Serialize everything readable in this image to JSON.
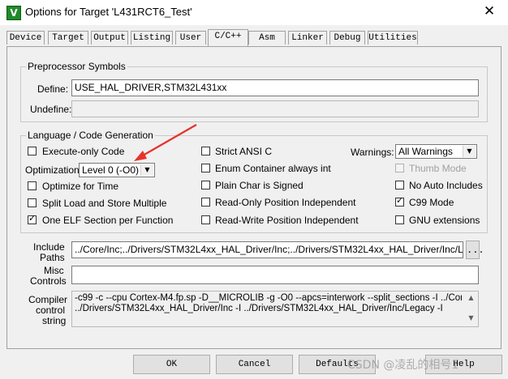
{
  "window": {
    "title": "Options for Target 'L431RCT6_Test'",
    "close_glyph": "✕"
  },
  "tabs": [
    {
      "label": "Device"
    },
    {
      "label": "Target"
    },
    {
      "label": "Output"
    },
    {
      "label": "Listing"
    },
    {
      "label": "User"
    },
    {
      "label": "C/C++"
    },
    {
      "label": "Asm"
    },
    {
      "label": "Linker"
    },
    {
      "label": "Debug"
    },
    {
      "label": "Utilities"
    }
  ],
  "active_tab": "C/C++",
  "preprocessor": {
    "group_label": "Preprocessor Symbols",
    "define_label": "Define:",
    "define_value": "USE_HAL_DRIVER,STM32L431xx",
    "undefine_label": "Undefine:",
    "undefine_value": ""
  },
  "language": {
    "group_label": "Language / Code Generation",
    "execute_only": {
      "label": "Execute-only Code",
      "checked": false
    },
    "optimization_label": "Optimization:",
    "optimization_value": "Level 0 (-O0)",
    "optimize_time": {
      "label": "Optimize for Time",
      "checked": false
    },
    "split_load": {
      "label": "Split Load and Store Multiple",
      "checked": false
    },
    "one_elf": {
      "label": "One ELF Section per Function",
      "checked": true
    },
    "strict_ansi": {
      "label": "Strict ANSI C",
      "checked": false
    },
    "enum_container": {
      "label": "Enum Container always int",
      "checked": false
    },
    "plain_char": {
      "label": "Plain Char is Signed",
      "checked": false
    },
    "readonly_pos": {
      "label": "Read-Only Position Independent",
      "checked": false
    },
    "readwrite_pos": {
      "label": "Read-Write Position Independent",
      "checked": false
    },
    "warnings_label": "Warnings:",
    "warnings_value": "All Warnings",
    "thumb_mode": {
      "label": "Thumb Mode",
      "checked": false,
      "disabled": true
    },
    "no_auto_includes": {
      "label": "No Auto Includes",
      "checked": false
    },
    "c99_mode": {
      "label": "C99 Mode",
      "checked": true
    },
    "gnu_extensions": {
      "label": "GNU extensions",
      "checked": false
    }
  },
  "include_paths": {
    "label_line1": "Include",
    "label_line2": "Paths",
    "value": "../Core/Inc;../Drivers/STM32L4xx_HAL_Driver/Inc;../Drivers/STM32L4xx_HAL_Driver/Inc/Legacy;",
    "browse_label": "..."
  },
  "misc_controls": {
    "label_line1": "Misc",
    "label_line2": "Controls",
    "value": ""
  },
  "compiler_control": {
    "label_line1": "Compiler",
    "label_line2": "control",
    "label_line3": "string",
    "line1": "-c99 -c --cpu Cortex-M4.fp.sp -D__MICROLIB -g -O0 --apcs=interwork --split_sections -I ../Core/Inc -I",
    "line2": "../Drivers/STM32L4xx_HAL_Driver/Inc -I ../Drivers/STM32L4xx_HAL_Driver/Inc/Legacy -I"
  },
  "buttons": {
    "ok": "OK",
    "cancel": "Cancel",
    "defaults": "Defaults",
    "help": "Help"
  },
  "watermark": "CSDN @凌乱的相号1",
  "colors": {
    "annotation_arrow": "#e8322b",
    "app_icon": "#1f8a2a"
  }
}
